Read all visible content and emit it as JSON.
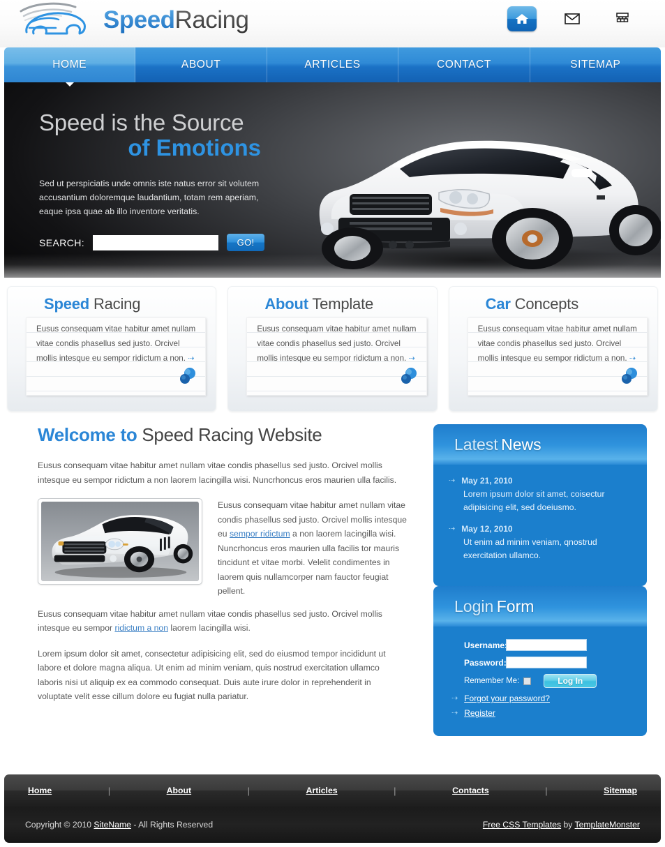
{
  "header": {
    "logo": {
      "part1": "Speed",
      "part2": "Racing",
      "icon": "car-logo-icon"
    },
    "icons": [
      {
        "name": "home-icon",
        "glyph": "home",
        "active": true
      },
      {
        "name": "mail-icon",
        "glyph": "mail",
        "active": false
      },
      {
        "name": "sitemap-icon",
        "glyph": "sitemap",
        "active": false
      }
    ]
  },
  "nav": {
    "items": [
      {
        "label": "HOME",
        "active": true
      },
      {
        "label": "ABOUT",
        "active": false
      },
      {
        "label": "ARTICLES",
        "active": false
      },
      {
        "label": "CONTACT",
        "active": false
      },
      {
        "label": "SITEMAP",
        "active": false
      }
    ]
  },
  "banner": {
    "title_line1": "Speed is the Source",
    "title_line2": "of Emotions",
    "description": "Sed ut perspiciatis unde omnis iste natus error sit volutem accusantium doloremque laudantium, totam rem aperiam, eaque ipsa quae ab illo inventore veritatis.",
    "search_label": "SEARCH:",
    "search_value": "",
    "search_placeholder": "",
    "go_label": "GO!",
    "image_alt": "white-suv-car"
  },
  "features": [
    {
      "title_blue": "Speed",
      "title_grey": "Racing",
      "body": "Eusus consequam vitae habitur amet nullam vitae condis phasellus sed justo. Orcivel mollis intesque eu sempor ridictum a non.",
      "more_icon": "dotted-arrow-icon",
      "pin_icon": "push-pin-icon"
    },
    {
      "title_blue": "About",
      "title_grey": "Template",
      "body": "Eusus consequam vitae habitur amet nullam vitae condis phasellus sed justo. Orcivel mollis intesque eu sempor ridictum a non.",
      "more_icon": "dotted-arrow-icon",
      "pin_icon": "push-pin-icon"
    },
    {
      "title_blue": "Car",
      "title_grey": "Concepts",
      "body": "Eusus consequam vitae habitur amet nullam vitae condis phasellus sed justo. Orcivel mollis intesque eu sempor ridictum a non.",
      "more_icon": "dotted-arrow-icon",
      "pin_icon": "push-pin-icon"
    }
  ],
  "content": {
    "title_blue": "Welcome to",
    "title_grey": "Speed Racing Website",
    "intro": "Eusus consequam vitae habitur amet nullam vitae condis phasellus sed justo. Orcivel mollis intesque eu sempor ridictum a non laorem lacingilla wisi. Nuncrhoncus eros maurien ulla facilis.",
    "image_alt": "white-sports-car-thumbnail",
    "media_text_1": "Eusus consequam vitae habitur amet nullam vitae condis phasellus sed justo. Orcivel mollis intesque eu ",
    "media_link": "sempor ridictum",
    "media_text_2": " a non laorem lacingilla wisi. Nuncrhoncus eros maurien ulla facilis tor mauris tincidunt et vitae morbi. Velelit condimentes in laorem quis nullamcorper nam fauctor feugiat pellent.",
    "para2_a": "Eusus consequam vitae habitur amet nullam vitae condis phasellus sed justo. Orcivel mollis intesque eu sempor ",
    "para2_link": "ridictum a non",
    "para2_b": " laorem lacingilla wisi.",
    "para3": "Lorem ipsum dolor sit amet, consectetur adipisicing elit, sed do eiusmod tempor incididunt ut labore et dolore magna aliqua. Ut enim ad minim veniam, quis nostrud exercitation ullamco laboris nisi ut aliquip ex ea commodo consequat. Duis aute irure dolor in reprehenderit in voluptate velit esse cillum dolore eu fugiat nulla pariatur."
  },
  "sidebar": {
    "news": {
      "title_lite": "Latest",
      "title_bold": "News",
      "items": [
        {
          "date": "May 21, 2010",
          "text": "Lorem ipsum dolor sit amet, coisectur adipisicing elit, sed doeiusmo.",
          "icon": "dotted-arrow-icon"
        },
        {
          "date": "May 12, 2010",
          "text": "Ut enim ad minim veniam, qnostrud exercitation ullamco.",
          "icon": "dotted-arrow-icon"
        }
      ]
    },
    "login": {
      "title_lite": "Login",
      "title_bold": "Form",
      "username_label": "Username:",
      "username_value": "",
      "password_label": "Password:",
      "password_value": "",
      "remember_label": "Remember Me:",
      "remember_checked": false,
      "submit_label": "Log In",
      "forgot_label": "Forgot your password?",
      "register_label": "Register",
      "link_icon": "dotted-arrow-icon"
    }
  },
  "footer": {
    "links": [
      "Home",
      "About",
      "Articles",
      "Contacts",
      "Sitemap"
    ],
    "separator": "|",
    "copyright_pre": "Copyright © 2010 ",
    "copyright_link": "SiteName",
    "copyright_post": " - All Rights Reserved",
    "credit_link1": "Free CSS Templates",
    "credit_mid": " by ",
    "credit_link2": "TemplateMonster"
  },
  "colors": {
    "accent_blue": "#2b86d6",
    "panel_blue": "#1b7fcd",
    "nav_blue": "#1b72c6",
    "login_btn": "#3dc0e0",
    "footer_dark": "#1e1e1e"
  }
}
